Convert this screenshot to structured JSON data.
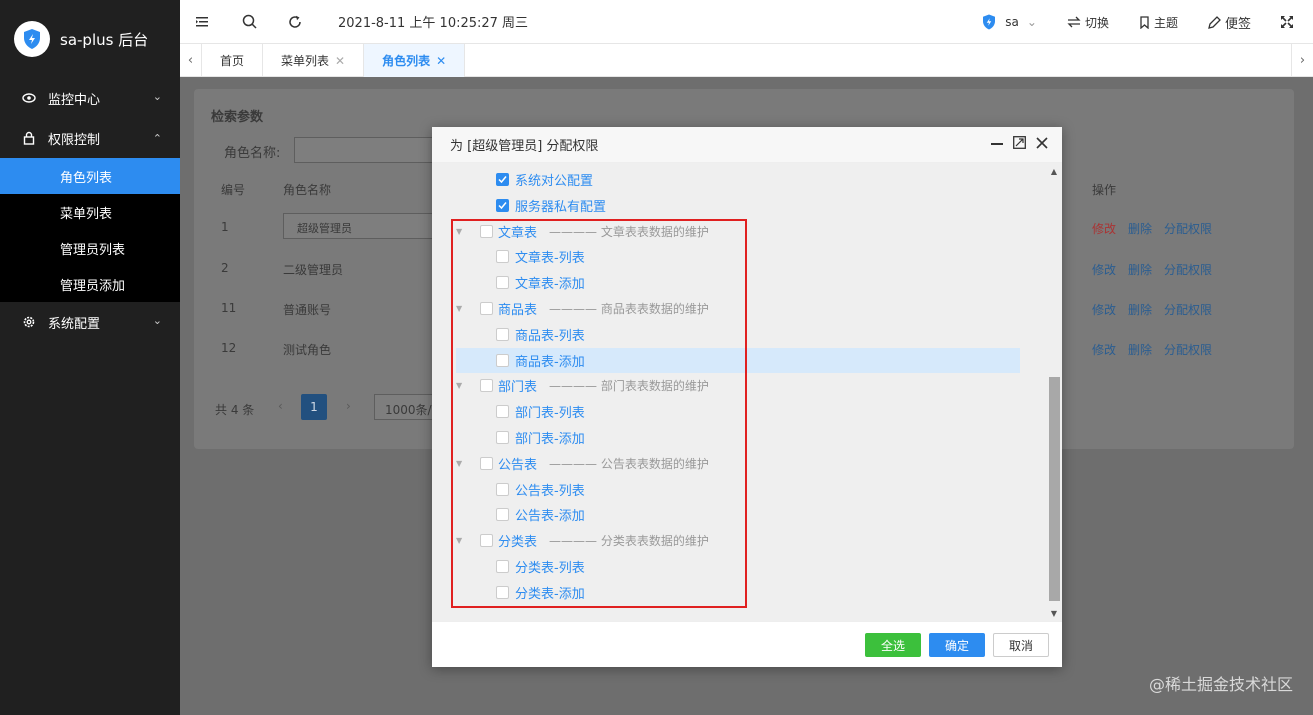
{
  "app": {
    "title": "sa-plus 后台"
  },
  "sidebar": {
    "items": [
      {
        "label": "监控中心",
        "icon": "eye-icon"
      },
      {
        "label": "权限控制",
        "icon": "lock-icon"
      },
      {
        "label": "系统配置",
        "icon": "gear-icon"
      }
    ],
    "sub_items": [
      {
        "label": "角色列表",
        "active": true
      },
      {
        "label": "菜单列表"
      },
      {
        "label": "管理员列表"
      },
      {
        "label": "管理员添加"
      }
    ]
  },
  "header": {
    "datetime": "2021-8-11 上午 10:25:27 周三",
    "user": "sa",
    "switch_label": "切换",
    "theme_label": "主题",
    "note_label": "便签"
  },
  "tabs": [
    {
      "label": "首页"
    },
    {
      "label": "菜单列表",
      "closable": true
    },
    {
      "label": "角色列表",
      "closable": true,
      "active": true
    }
  ],
  "background_page": {
    "search_title": "检索参数",
    "role_name_label": "角色名称:",
    "columns": [
      "编号",
      "角色名称",
      "操作"
    ],
    "rows": [
      {
        "id": "1",
        "name": "超级管理员"
      },
      {
        "id": "2",
        "name": "二级管理员"
      },
      {
        "id": "11",
        "name": "普通账号"
      },
      {
        "id": "12",
        "name": "测试角色"
      }
    ],
    "actions": [
      "修改",
      "删除",
      "分配权限"
    ],
    "total": "共 4 条",
    "current_page": "1",
    "page_size": "1000条/"
  },
  "modal": {
    "title": "为 [超级管理员] 分配权限",
    "tree": [
      {
        "level": 2,
        "label": "系统对公配置",
        "checked": true
      },
      {
        "level": 2,
        "label": "服务器私有配置",
        "checked": true
      },
      {
        "level": 1,
        "label": "文章表",
        "desc": "———— 文章表表数据的维护"
      },
      {
        "level": 2,
        "label": "文章表-列表"
      },
      {
        "level": 2,
        "label": "文章表-添加"
      },
      {
        "level": 1,
        "label": "商品表",
        "desc": "———— 商品表表数据的维护"
      },
      {
        "level": 2,
        "label": "商品表-列表"
      },
      {
        "level": 2,
        "label": "商品表-添加",
        "highlight": true
      },
      {
        "level": 1,
        "label": "部门表",
        "desc": "———— 部门表表数据的维护"
      },
      {
        "level": 2,
        "label": "部门表-列表"
      },
      {
        "level": 2,
        "label": "部门表-添加"
      },
      {
        "level": 1,
        "label": "公告表",
        "desc": "———— 公告表表数据的维护"
      },
      {
        "level": 2,
        "label": "公告表-列表"
      },
      {
        "level": 2,
        "label": "公告表-添加"
      },
      {
        "level": 1,
        "label": "分类表",
        "desc": "———— 分类表表数据的维护"
      },
      {
        "level": 2,
        "label": "分类表-列表"
      },
      {
        "level": 2,
        "label": "分类表-添加"
      }
    ],
    "buttons": {
      "select_all": "全选",
      "confirm": "确定",
      "cancel": "取消"
    }
  },
  "watermark": "@稀土掘金技术社区",
  "colors": {
    "accent": "#2d8cf0",
    "sidebar_bg": "#202020",
    "select_all": "#3cc03c",
    "highlight_box": "#e02020"
  }
}
